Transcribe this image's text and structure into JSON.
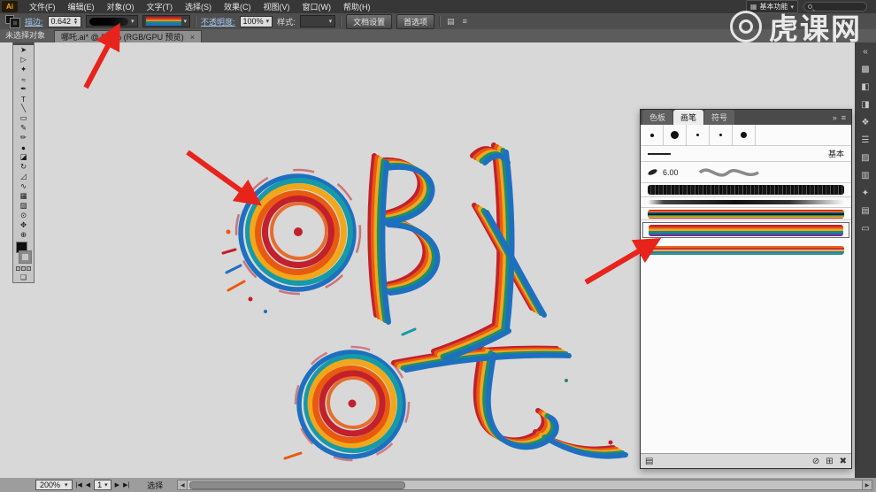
{
  "menu_bar": {
    "logo": "Ai",
    "items": [
      "文件(F)",
      "编辑(E)",
      "对象(O)",
      "文字(T)",
      "选择(S)",
      "效果(C)",
      "视图(V)",
      "窗口(W)",
      "帮助(H)"
    ],
    "workspace": "基本功能"
  },
  "control_bar": {
    "stroke_label": "描边:",
    "stroke_value": "0.642",
    "opacity_label": "不透明度:",
    "opacity_value": "100%",
    "style_label": "样式:",
    "doc_setup_button": "文档设置",
    "preferences_button": "首选项"
  },
  "tab_bar": {
    "no_selection": "未选择对象",
    "document_title": "哪吒.ai* @ 200% (RGB/GPU 预览)",
    "close": "×"
  },
  "toolbar": {
    "tools": [
      {
        "name": "selection-tool",
        "glyph": "➤"
      },
      {
        "name": "direct-selection-tool",
        "glyph": "▷"
      },
      {
        "name": "magic-wand-tool",
        "glyph": "✦"
      },
      {
        "name": "lasso-tool",
        "glyph": "≈"
      },
      {
        "name": "pen-tool",
        "glyph": "✒"
      },
      {
        "name": "type-tool",
        "glyph": "T"
      },
      {
        "name": "line-segment-tool",
        "glyph": "╲"
      },
      {
        "name": "rectangle-tool",
        "glyph": "▭"
      },
      {
        "name": "paintbrush-tool",
        "glyph": "✎"
      },
      {
        "name": "pencil-tool",
        "glyph": "✏"
      },
      {
        "name": "blob-brush-tool",
        "glyph": "●"
      },
      {
        "name": "eraser-tool",
        "glyph": "◪"
      },
      {
        "name": "rotate-tool",
        "glyph": "↻"
      },
      {
        "name": "scale-tool",
        "glyph": "◿"
      },
      {
        "name": "width-tool",
        "glyph": "∿"
      },
      {
        "name": "mesh-tool",
        "glyph": "▦"
      },
      {
        "name": "gradient-tool",
        "glyph": "▨"
      },
      {
        "name": "eyedropper-tool",
        "glyph": "⊙"
      },
      {
        "name": "hand-tool",
        "glyph": "✥"
      },
      {
        "name": "zoom-tool",
        "glyph": "⊕"
      }
    ]
  },
  "artwork": {
    "characters": "哪吒"
  },
  "watermark": {
    "text": "虎课网"
  },
  "brushes_panel": {
    "tabs": [
      {
        "label": "色板",
        "active": false
      },
      {
        "label": "画笔",
        "active": true
      },
      {
        "label": "符号",
        "active": false
      }
    ],
    "dot_brush_sizes": [
      4,
      9,
      3,
      3,
      7
    ],
    "basic_brush_label": "基本",
    "calligraphic_brush_label": "6.00",
    "art_brushes": [
      "charcoal",
      "scratch-line",
      "color-stripes",
      "rainbow-paint",
      "rainbow-rough"
    ],
    "selected_brush": "rainbow-paint"
  },
  "dock": {
    "icons": [
      {
        "name": "collapse-dock-icon",
        "glyph": "«"
      },
      {
        "name": "color-panel-icon",
        "glyph": "▩"
      },
      {
        "name": "color-guide-panel-icon",
        "glyph": "◧"
      },
      {
        "name": "appearance-panel-icon",
        "glyph": "◨"
      },
      {
        "name": "graphic-styles-panel-icon",
        "glyph": "❖"
      },
      {
        "name": "stroke-panel-icon",
        "glyph": "☰"
      },
      {
        "name": "gradient-panel-icon",
        "glyph": "▨"
      },
      {
        "name": "transparency-panel-icon",
        "glyph": "▥"
      },
      {
        "name": "symbols-panel-icon",
        "glyph": "✦"
      },
      {
        "name": "layers-panel-icon",
        "glyph": "▤"
      },
      {
        "name": "artboards-panel-icon",
        "glyph": "▭"
      }
    ]
  },
  "status_bar": {
    "zoom": "200%",
    "artboard": "1",
    "mode": "选择"
  }
}
